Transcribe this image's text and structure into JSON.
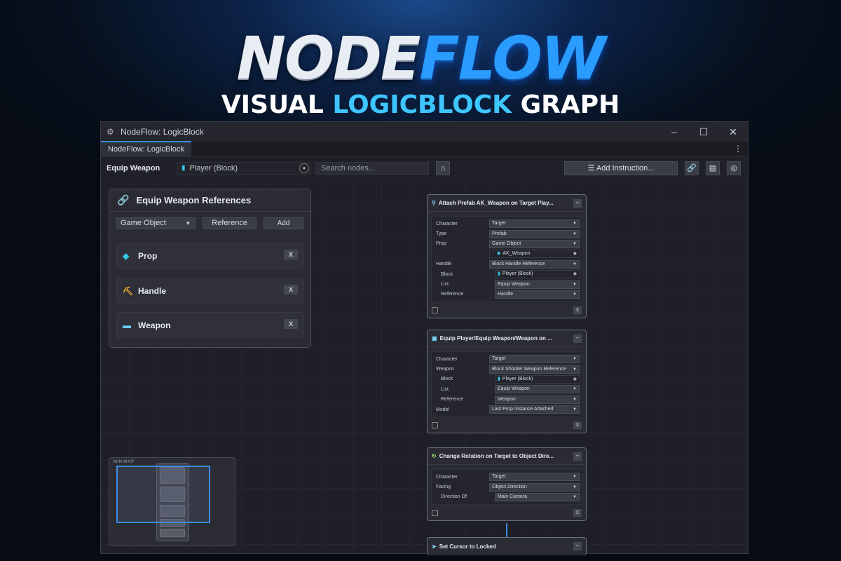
{
  "hero": {
    "title_part1": "NODE",
    "title_part2": "FLOW",
    "subtitle_part1": "VISUAL ",
    "subtitle_part2": "LOGICBLOCK",
    "subtitle_part3": " GRAPH"
  },
  "window": {
    "title": "NodeFlow: LogicBlock",
    "tab": "NodeFlow: LogicBlock"
  },
  "toolbar": {
    "name": "Equip Weapon",
    "object": "Player (Block)",
    "search_placeholder": "Search nodes...",
    "add_instruction": "Add Instruction..."
  },
  "references": {
    "title": "Equip Weapon References",
    "type_select": "Game Object",
    "field_label": "Reference",
    "add_label": "Add",
    "items": [
      {
        "label": "Prop",
        "remove": "X"
      },
      {
        "label": "Handle",
        "remove": "X"
      },
      {
        "label": "Weapon",
        "remove": "X"
      }
    ]
  },
  "minimap": {
    "label": "MINIMAP"
  },
  "nodes": [
    {
      "title": "Attach Prefab AK_Weapon on Target Play...",
      "rows": [
        {
          "label": "Character",
          "value": "Target"
        },
        {
          "label": "Type",
          "value": "Prefab"
        },
        {
          "label": "Prop",
          "value": "Game Object"
        },
        {
          "label": "",
          "value": "AK_Weapon"
        },
        {
          "label": "Handle",
          "value": "Block Handle Reference"
        },
        {
          "label": "Block",
          "value": "Player (Block)"
        },
        {
          "label": "List",
          "value": "Equip Weapon"
        },
        {
          "label": "Reference",
          "value": "Handle"
        }
      ],
      "close": "X"
    },
    {
      "title": "Equip Player/Equip Weapon/Weapon on ...",
      "rows": [
        {
          "label": "Character",
          "value": "Target"
        },
        {
          "label": "Weapon",
          "value": "Block Shooter Weapon Reference"
        },
        {
          "label": "Block",
          "value": "Player (Block)"
        },
        {
          "label": "List",
          "value": "Equip Weapon"
        },
        {
          "label": "Reference",
          "value": "Weapon"
        },
        {
          "label": "Model",
          "value": "Last Prop Instance Attached"
        }
      ],
      "close": "X"
    },
    {
      "title": "Change Rotation on Target to Object Dire...",
      "rows": [
        {
          "label": "Character",
          "value": "Target"
        },
        {
          "label": "Facing",
          "value": "Object Direction"
        },
        {
          "label": "Direction Of",
          "value": "Main Camera"
        }
      ],
      "close": "X"
    },
    {
      "title": "Set Cursor to Locked"
    }
  ],
  "colors": {
    "accent": "#3b8de8",
    "cyan": "#3dc6ff"
  }
}
